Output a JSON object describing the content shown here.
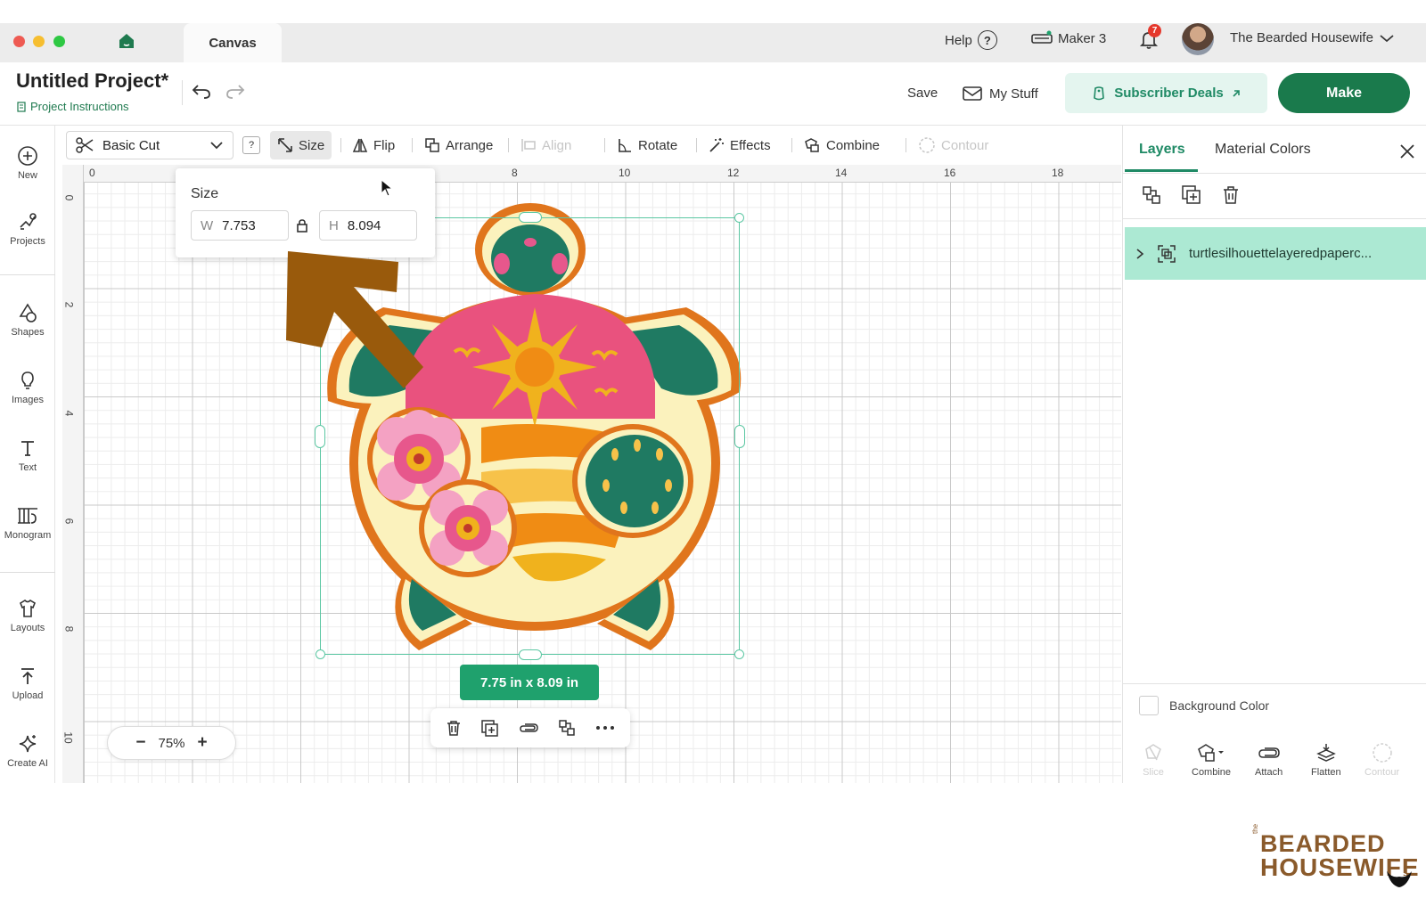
{
  "titlebar": {
    "tab_label": "Canvas",
    "help_label": "Help",
    "help_symbol": "?",
    "machine_label": "Maker 3",
    "notification_count": "7",
    "user_name": "The Bearded Housewife"
  },
  "project": {
    "title": "Untitled Project*",
    "instructions_label": "Project Instructions",
    "save_label": "Save",
    "mystuff_label": "My Stuff",
    "subscriber_deals_label": "Subscriber Deals",
    "make_label": "Make"
  },
  "sidebar": {
    "items": [
      {
        "label": "New",
        "icon": "plus-circle-icon"
      },
      {
        "label": "Projects",
        "icon": "projects-icon"
      },
      {
        "label": "Shapes",
        "icon": "shapes-icon"
      },
      {
        "label": "Images",
        "icon": "lightbulb-icon"
      },
      {
        "label": "Text",
        "icon": "text-icon"
      },
      {
        "label": "Monogram",
        "icon": "monogram-icon"
      },
      {
        "label": "Layouts",
        "icon": "layouts-icon"
      },
      {
        "label": "Upload",
        "icon": "upload-icon"
      },
      {
        "label": "Create AI",
        "icon": "sparkle-icon"
      }
    ]
  },
  "toolbar": {
    "operation": "Basic Cut",
    "help": "?",
    "size": "Size",
    "flip": "Flip",
    "arrange": "Arrange",
    "align": "Align",
    "rotate": "Rotate",
    "effects": "Effects",
    "combine": "Combine",
    "contour": "Contour"
  },
  "ruler": {
    "top": [
      "0",
      "8",
      "10",
      "12",
      "14",
      "16",
      "18"
    ],
    "left": [
      "0",
      "2",
      "4",
      "6",
      "8",
      "10"
    ]
  },
  "size_popup": {
    "title": "Size",
    "w_prefix": "W",
    "w_value": "7.753",
    "h_prefix": "H",
    "h_value": "8.094"
  },
  "selection": {
    "dimensions": "7.75  in x 8.09  in"
  },
  "zoom": {
    "minus": "−",
    "value": "75%",
    "plus": "+"
  },
  "right_panel": {
    "tabs": [
      "Layers",
      "Material Colors"
    ],
    "layer_name": "turtlesilhouettelayeredpaperc...",
    "background_color_label": "Background Color",
    "tools": [
      {
        "label": "Slice",
        "enabled": false
      },
      {
        "label": "Combine",
        "enabled": true
      },
      {
        "label": "Attach",
        "enabled": true
      },
      {
        "label": "Flatten",
        "enabled": true
      },
      {
        "label": "Contour",
        "enabled": false
      }
    ]
  },
  "watermark": {
    "small": "the",
    "line1": "BEARDED",
    "line2": "HOUSEWIFE"
  },
  "colors": {
    "accent": "#1a7a4c",
    "selection": "#5cc7a3",
    "layer_highlight": "#ace9d3",
    "arrow": "#995a0c"
  }
}
